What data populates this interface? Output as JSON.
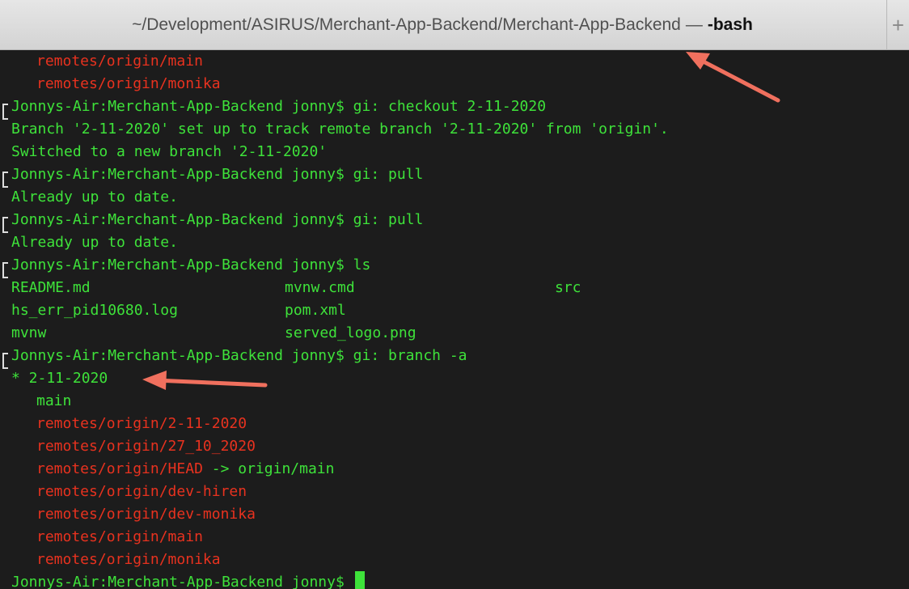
{
  "window": {
    "tab_path": "~/Development/ASIRUS/Merchant-App-Backend/Merchant-App-Backend",
    "tab_separator": "—",
    "tab_process": "-bash",
    "new_tab_symbol": "+"
  },
  "terminal": {
    "lines": [
      "remotes/origin/main",
      "remotes/origin/monika",
      "Jonnys-Air:Merchant-App-Backend jonny$ gi: checkout 2-11-2020",
      "Branch '2-11-2020' set up to track remote branch '2-11-2020' from 'origin'.",
      "Switched to a new branch '2-11-2020'",
      "Jonnys-Air:Merchant-App-Backend jonny$ gi: pull",
      "Already up to date.",
      "Jonnys-Air:Merchant-App-Backend jonny$ gi: pull",
      "Already up to date.",
      "Jonnys-Air:Merchant-App-Backend jonny$ ls",
      "Jonnys-Air:Merchant-App-Backend jonny$ gi: branch -a",
      "* 2-11-2020",
      "main",
      "remotes/origin/2-11-2020",
      "remotes/origin/27_10_2020",
      "remotes/origin/HEAD",
      " -> origin/main",
      "remotes/origin/dev-hiren",
      "remotes/origin/dev-monika",
      "remotes/origin/main",
      "remotes/origin/monika",
      "Jonnys-Air:Merchant-App-Backend jonny$ "
    ],
    "ls_output": [
      [
        "README.md",
        "mvnw.cmd",
        "src"
      ],
      [
        "hs_err_pid10680.log",
        "pom.xml",
        ""
      ],
      [
        "mvnw",
        "served_logo.png",
        ""
      ]
    ]
  },
  "colors": {
    "background": "#1c1c1c",
    "green_text": "#3ee23a",
    "red_text": "#e8321f",
    "arrow": "#f0705e",
    "titlebar": "#dcdcdc"
  },
  "icons": [
    "cursor-block",
    "annotation-arrow"
  ]
}
